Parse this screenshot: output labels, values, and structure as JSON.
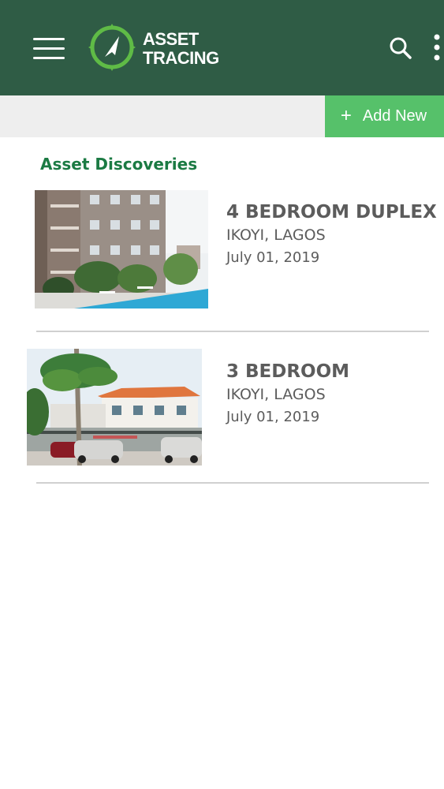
{
  "app": {
    "brand_line1": "ASSET",
    "brand_line2": "TRACING"
  },
  "header": {
    "menu_icon": "hamburger-icon",
    "search_icon": "search-icon",
    "more_icon": "more-vertical-icon"
  },
  "toolbar": {
    "add_icon": "+",
    "add_label": "Add New"
  },
  "section": {
    "title": "Asset Discoveries"
  },
  "listings": [
    {
      "title": "4 BEDROOM DUPLEX",
      "location": "IKOYI, LAGOS",
      "date": "July 01, 2019"
    },
    {
      "title": "3 BEDROOM",
      "location": "IKOYI, LAGOS",
      "date": "July 01, 2019"
    }
  ],
  "colors": {
    "app_bar": "#2f5c45",
    "add_button": "#56c16a",
    "section_title": "#1b7a43",
    "text": "#5c5c5c",
    "logo_green": "#5fbb46"
  }
}
